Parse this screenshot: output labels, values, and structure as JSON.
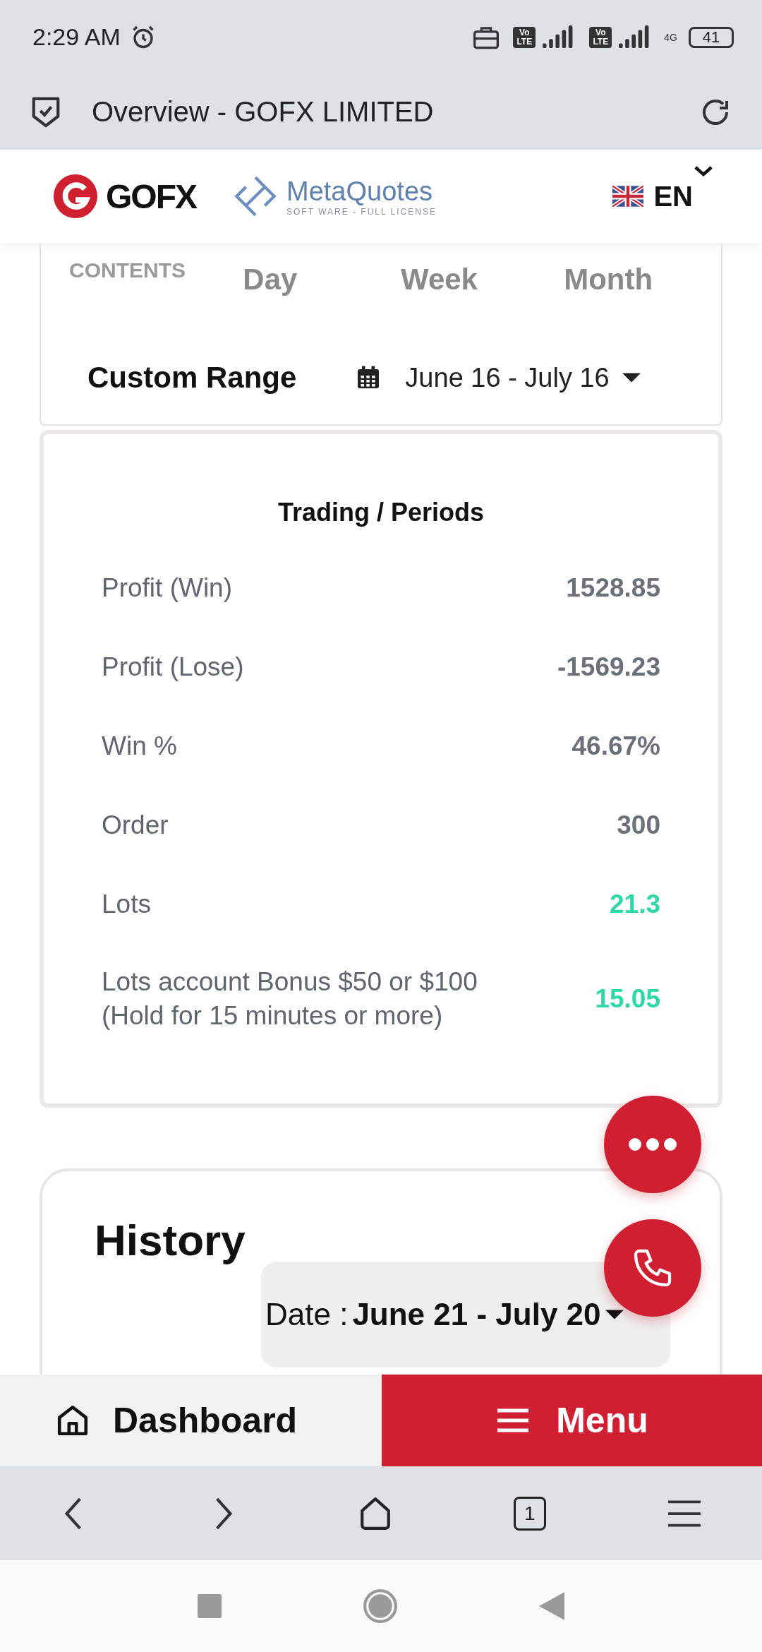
{
  "status_bar": {
    "time": "2:29 AM",
    "sim_badges": [
      "Vo LTE",
      "Vo LTE"
    ],
    "network": "4G",
    "battery": "41"
  },
  "browser": {
    "title": "Overview - GOFX LIMITED",
    "tab_count": "1"
  },
  "header": {
    "brand": "GOFX",
    "partner": "MetaQuotes",
    "partner_tagline": "SOFT WARE - FULL LICENSE",
    "language": "EN"
  },
  "period": {
    "label": "CONTENTS",
    "tabs": [
      {
        "label": "Day",
        "selected": false
      },
      {
        "label": "Week",
        "selected": false
      },
      {
        "label": "Month",
        "selected": false
      }
    ],
    "custom_range": {
      "label": "Custom Range",
      "selected": true
    },
    "date_range": "June 16 - July 16"
  },
  "stats": {
    "title": "Trading / Periods",
    "rows": [
      {
        "label": "Profit (Win)",
        "value": "1528.85",
        "highlight": false
      },
      {
        "label": "Profit (Lose)",
        "value": "-1569.23",
        "highlight": false
      },
      {
        "label": "Win %",
        "value": "46.67%",
        "highlight": false
      },
      {
        "label": "Order",
        "value": "300",
        "highlight": false
      },
      {
        "label": "Lots",
        "value": "21.3",
        "highlight": true
      },
      {
        "label": "Lots account Bonus $50 or $100\n(Hold for 15 minutes or more)",
        "value": "15.05",
        "highlight": true
      }
    ]
  },
  "history": {
    "title": "History",
    "date_label": "Date :",
    "date_range": "June 21 - July 20"
  },
  "bottom_nav": {
    "dashboard": "Dashboard",
    "menu": "Menu"
  }
}
